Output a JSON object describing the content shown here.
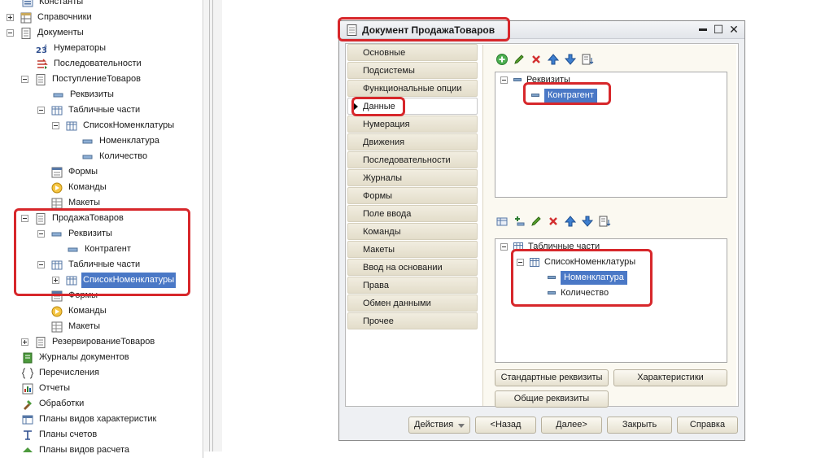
{
  "tree": {
    "items": [
      {
        "label": "Константы"
      },
      {
        "label": "Справочники"
      },
      {
        "label": "Документы"
      },
      {
        "label": "Нумераторы"
      },
      {
        "label": "Последовательности"
      },
      {
        "label": "ПоступлениеТоваров"
      },
      {
        "label": "Реквизиты"
      },
      {
        "label": "Табличные части"
      },
      {
        "label": "СписокНоменклатуры"
      },
      {
        "label": "Номенклатура"
      },
      {
        "label": "Количество"
      },
      {
        "label": "Формы"
      },
      {
        "label": "Команды"
      },
      {
        "label": "Макеты"
      },
      {
        "label": "ПродажаТоваров"
      },
      {
        "label": "Реквизиты"
      },
      {
        "label": "Контрагент"
      },
      {
        "label": "Табличные части"
      },
      {
        "label": "СписокНоменклатуры"
      },
      {
        "label": "Формы"
      },
      {
        "label": "Команды"
      },
      {
        "label": "Макеты"
      },
      {
        "label": "РезервированиеТоваров"
      },
      {
        "label": "Журналы документов"
      },
      {
        "label": "Перечисления"
      },
      {
        "label": "Отчеты"
      },
      {
        "label": "Обработки"
      },
      {
        "label": "Планы видов характеристик"
      },
      {
        "label": "Планы счетов"
      },
      {
        "label": "Планы видов расчета"
      }
    ]
  },
  "window": {
    "title": "Документ ПродажаТоваров",
    "controls": {
      "minimize": "▬",
      "maximize": "☐",
      "close": "✕"
    },
    "tabs": [
      {
        "label": "Основные"
      },
      {
        "label": "Подсистемы"
      },
      {
        "label": "Функциональные опции"
      },
      {
        "label": "Данные"
      },
      {
        "label": "Нумерация"
      },
      {
        "label": "Движения"
      },
      {
        "label": "Последовательности"
      },
      {
        "label": "Журналы"
      },
      {
        "label": "Формы"
      },
      {
        "label": "Поле ввода"
      },
      {
        "label": "Команды"
      },
      {
        "label": "Макеты"
      },
      {
        "label": "Ввод на основании"
      },
      {
        "label": "Права"
      },
      {
        "label": "Обмен данными"
      },
      {
        "label": "Прочее"
      }
    ],
    "active_tab": "Данные",
    "attributes": {
      "root": "Реквизиты",
      "items": [
        "Контрагент"
      ]
    },
    "tabular": {
      "root": "Табличные части",
      "section": "СписокНоменклатуры",
      "items": [
        "Номенклатура",
        "Количество"
      ]
    },
    "buttons": {
      "standard_attrs": "Стандартные реквизиты",
      "characteristics": "Характеристики",
      "common_attrs": "Общие реквизиты"
    },
    "footer": {
      "actions": "Действия",
      "back": "<Назад",
      "next": "Далее>",
      "close": "Закрыть",
      "help": "Справка"
    }
  },
  "colors": {
    "highlight": "#d7272b",
    "selection": "#4a78c6"
  }
}
